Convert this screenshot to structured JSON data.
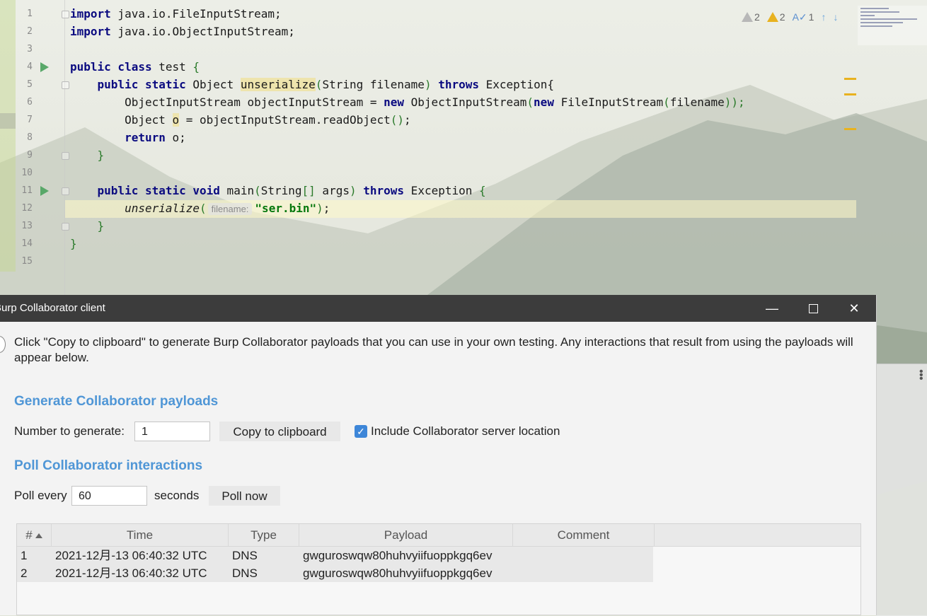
{
  "editor": {
    "lines": [
      {
        "n": "1"
      },
      {
        "n": "2"
      },
      {
        "n": "3"
      },
      {
        "n": "4"
      },
      {
        "n": "5"
      },
      {
        "n": "6"
      },
      {
        "n": "7"
      },
      {
        "n": "8"
      },
      {
        "n": "9"
      },
      {
        "n": "10"
      },
      {
        "n": "11"
      },
      {
        "n": "12"
      },
      {
        "n": "13"
      },
      {
        "n": "14"
      },
      {
        "n": "15"
      }
    ],
    "code": {
      "l1_kw": "import",
      "l1_rest": " java.io.FileInputStream;",
      "l2_kw": "import",
      "l2_rest": " java.io.ObjectInputStream;",
      "l4_kw": "public class",
      "l4_name": " test ",
      "l4_brace": "{",
      "l5_kw": "public static",
      "l5_type": " Object ",
      "l5_method": "unserialize",
      "l5_p1": "(",
      "l5_params": "String filename",
      "l5_p2": ")",
      "l5_throws": " throws",
      "l5_exc": " Exception{",
      "l6_a": "ObjectInputStream objectInputStream = ",
      "l6_new": "new",
      "l6_b": " ObjectInputStream",
      "l6_p1": "(",
      "l6_new2": "new",
      "l6_c": " FileInputStream",
      "l6_p2": "(",
      "l6_d": "filename",
      "l6_p3": "));",
      "l7_a": "Object ",
      "l7_o": "o",
      "l7_b": " = objectInputStream.readObject",
      "l7_p": "()",
      "l7_c": ";",
      "l8_kw": "return",
      "l8_rest": " o;",
      "l9": "}",
      "l11_kw": "public static void",
      "l11_name": " main",
      "l11_p1": "(",
      "l11_params": "String",
      "l11_br": "[]",
      "l11_args": " args",
      "l11_p2": ")",
      "l11_throws": " throws",
      "l11_exc": " Exception ",
      "l11_brace": "{",
      "l12_call": "unserialize",
      "l12_p1": "(",
      "l12_hint": "filename:",
      "l12_str": "\"ser.bin\"",
      "l12_p2": ")",
      "l12_end": ";",
      "l13": "}",
      "l14": "}"
    },
    "inspections": {
      "weak_warnings": "2",
      "warnings": "2",
      "typos": "1"
    }
  },
  "dialog": {
    "title": "Burp Collaborator client",
    "description": "Click \"Copy to clipboard\" to generate Burp Collaborator payloads that you can use in your own testing. Any interactions that result from using the payloads will appear below.",
    "generate": {
      "heading": "Generate Collaborator payloads",
      "number_label": "Number to generate:",
      "number_value": "1",
      "copy_button": "Copy to clipboard",
      "include_label": "Include Collaborator server location",
      "include_checked": true
    },
    "poll": {
      "heading": "Poll Collaborator interactions",
      "poll_every_label": "Poll every",
      "poll_value": "60",
      "seconds_label": "seconds",
      "poll_now_button": "Poll now"
    },
    "table": {
      "columns": [
        "#",
        "Time",
        "Type",
        "Payload",
        "Comment"
      ],
      "rows": [
        {
          "num": "1",
          "time": "2021-12月-13 06:40:32 UTC",
          "type": "DNS",
          "payload": "gwguroswqw80huhvyiifuoppkgq6ev",
          "comment": ""
        },
        {
          "num": "2",
          "time": "2021-12月-13 06:40:32 UTC",
          "type": "DNS",
          "payload": "gwguroswqw80huhvyiifuoppkgq6ev",
          "comment": ""
        }
      ]
    }
  },
  "colors": {
    "accent": "#4f96d6",
    "titlebar": "#3c3c3c",
    "keyword": "#0a0a80",
    "string": "#06780d",
    "warning": "#e8b21f"
  }
}
